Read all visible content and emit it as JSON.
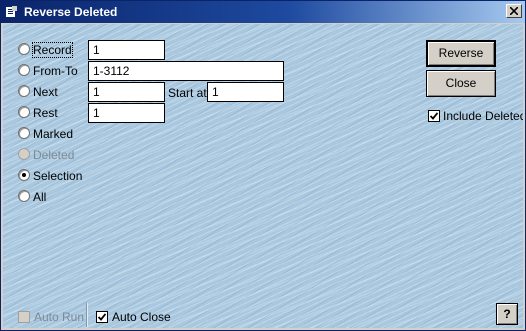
{
  "window": {
    "title": "Reverse Deleted",
    "close_label": "close"
  },
  "scope": {
    "record": {
      "label": "Record",
      "value": "1",
      "selected": false
    },
    "from_to": {
      "label": "From-To",
      "value": "1-3112",
      "selected": false
    },
    "next": {
      "label": "Next",
      "value": "1",
      "selected": false
    },
    "start_at": {
      "label": "Start at:",
      "value": "1"
    },
    "rest": {
      "label": "Rest",
      "value": "1",
      "selected": false
    },
    "marked": {
      "label": "Marked",
      "selected": false
    },
    "deleted": {
      "label": "Deleted",
      "selected": false,
      "disabled": true
    },
    "selection": {
      "label": "Selection",
      "selected": true
    },
    "all": {
      "label": "All",
      "selected": false
    }
  },
  "buttons": {
    "reverse": "Reverse",
    "close": "Close",
    "help": "?"
  },
  "options": {
    "include_deleted": {
      "label": "Include Deleted",
      "checked": true
    },
    "auto_run": {
      "label": "Auto Run",
      "checked": false,
      "disabled": true
    },
    "auto_close": {
      "label": "Auto Close",
      "checked": true
    }
  }
}
